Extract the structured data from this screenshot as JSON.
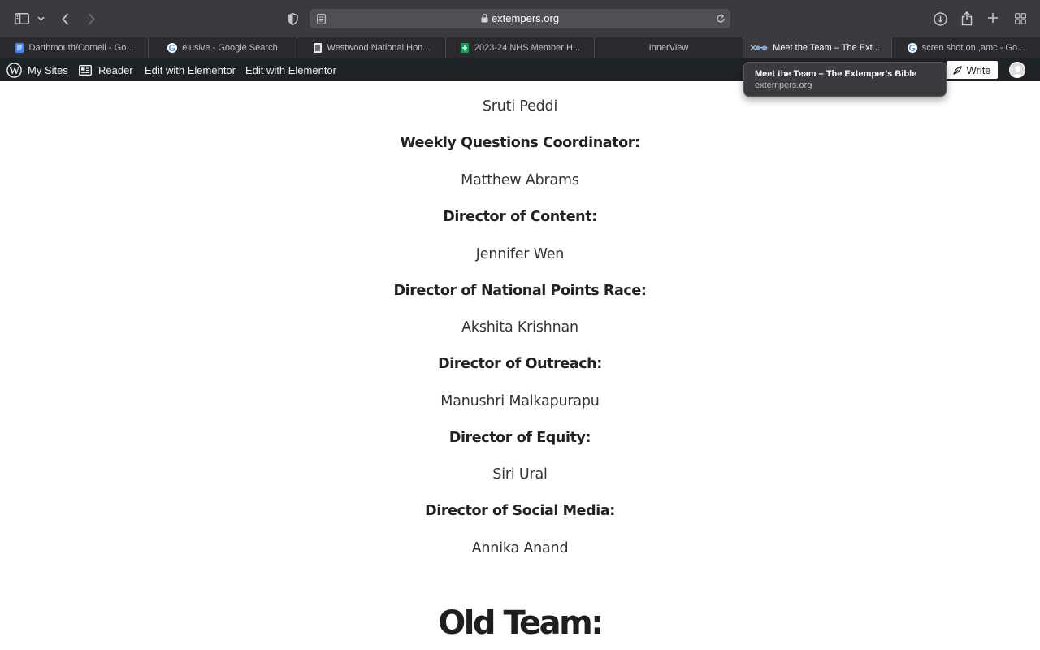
{
  "browser": {
    "url": "extempers.org",
    "tooltip": {
      "title": "Meet the Team – The Extemper's Bible",
      "subtitle": "extempers.org"
    },
    "tabs": [
      {
        "label": "Darthmouth/Cornell - Go...",
        "icon": "google-docs-icon"
      },
      {
        "label": "elusive - Google Search",
        "icon": "google-icon"
      },
      {
        "label": "Westwood National Hon...",
        "icon": "document-icon"
      },
      {
        "label": "2023-24 NHS Member H...",
        "icon": "google-sheets-icon"
      },
      {
        "label": "InnerView",
        "icon": ""
      },
      {
        "label": "Meet the Team – The Ext...",
        "icon": "glasses-icon",
        "active": true
      },
      {
        "label": "scren shot on ,amc - Go...",
        "icon": "google-icon"
      }
    ]
  },
  "admin_bar": {
    "my_sites": "My Sites",
    "reader": "Reader",
    "edit1": "Edit with Elementor",
    "edit2": "Edit with Elementor",
    "write": "Write"
  },
  "team": {
    "p0": "Sruti Peddi",
    "r1": "Weekly Questions Coordinator:",
    "p1": "Matthew Abrams",
    "r2": "Director of Content:",
    "p2": "Jennifer Wen",
    "r3": "Director of National Points Race:",
    "p3": "Akshita Krishnan",
    "r4": "Director of Outreach:",
    "p4": "Manushri Malkapurapu",
    "r5": "Director of Equity:",
    "p5": "Siri Ural",
    "r6": "Director of Social Media:",
    "p6": "Annika Anand",
    "old_team_heading": "Old Team:"
  }
}
